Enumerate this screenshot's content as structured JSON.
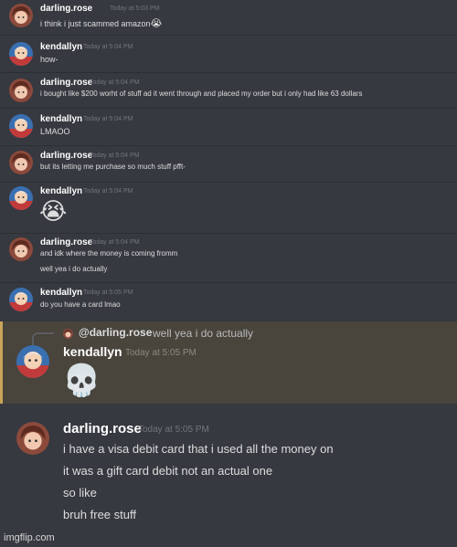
{
  "messages": [
    {
      "user": "darling.rose",
      "time": "Today at 5:03 PM",
      "lines": [
        "i think i just scammed amazon"
      ],
      "emoji": "😭"
    },
    {
      "user": "kendallyn",
      "time": "Today at 5:04 PM",
      "lines": [
        "how-"
      ]
    },
    {
      "user": "darling.rose",
      "time": "Today at 5:04 PM",
      "lines": [
        "i bought like $200 worht of stuff ad it went through and placed my order but i only had like 63 dollars"
      ]
    },
    {
      "user": "kendallyn",
      "time": "Today at 5:04 PM",
      "lines": [
        "LMAOO"
      ]
    },
    {
      "user": "darling.rose",
      "time": "Today at 5:04 PM",
      "lines": [
        "but its letting me purchase so much stuff pfft-"
      ]
    },
    {
      "user": "kendallyn",
      "time": "Today at 5:04 PM",
      "emoji_only": "😭"
    },
    {
      "user": "darling.rose",
      "time": "Today at 5:04 PM",
      "lines": [
        "and idk where the money is coming fromm",
        "well yea i do actually"
      ]
    },
    {
      "user": "kendallyn",
      "time": "Today at 5:05 PM",
      "lines": [
        "do you have a card lmao"
      ]
    }
  ],
  "reply": {
    "mention": "@darling.rose",
    "quoted": "well yea i do actually",
    "user": "kendallyn",
    "time": "Today at 5:05 PM",
    "emoji": "💀"
  },
  "final": {
    "user": "darling.rose",
    "time": "Today at 5:05 PM",
    "lines": [
      "i have a visa debit card that i used all the money on",
      "it was a gift card debit not an actual one",
      "so like",
      "bruh free stuff"
    ]
  },
  "watermark": "imgflip.com",
  "colors": {
    "background": "#36393f",
    "highlight": "#49443c",
    "highlight_bar": "#c9a55a",
    "username": "#ffffff",
    "timestamp": "#72767d"
  }
}
